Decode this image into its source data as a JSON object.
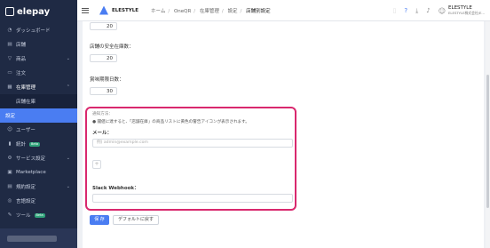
{
  "sidebar": {
    "brand": "elepay",
    "items": [
      {
        "label": "ダッシュボード",
        "icon": "dashboard-icon",
        "glyph": "◔"
      },
      {
        "label": "店舗",
        "icon": "store-icon",
        "glyph": "▤"
      },
      {
        "label": "商品",
        "icon": "tag-icon",
        "glyph": "▽"
      },
      {
        "label": "注文",
        "icon": "order-icon",
        "glyph": "▭"
      },
      {
        "label": "在庫管理",
        "icon": "inventory-icon",
        "glyph": "▦"
      },
      {
        "label": "店舗在庫",
        "icon": "",
        "glyph": ""
      },
      {
        "label": "設定",
        "icon": "",
        "glyph": ""
      },
      {
        "label": "ユーザー",
        "icon": "user-icon",
        "glyph": "☺"
      },
      {
        "label": "統計",
        "icon": "chart-icon",
        "glyph": "▮",
        "badge": "Beta"
      },
      {
        "label": "サービス設定",
        "icon": "gear-icon",
        "glyph": "⚙"
      },
      {
        "label": "Marketplace",
        "icon": "marketplace-icon",
        "glyph": "▣"
      },
      {
        "label": "規約設定",
        "icon": "document-icon",
        "glyph": "▤"
      },
      {
        "label": "言語設定",
        "icon": "globe-icon",
        "glyph": "◎"
      },
      {
        "label": "ツール",
        "icon": "wrench-icon",
        "glyph": "✎",
        "badge": "Beta"
      }
    ]
  },
  "topbar": {
    "brand": "ELESTYLE",
    "breadcrumbs": [
      "ホーム",
      "OneQR",
      "在庫管理",
      "設定",
      "店舗別設定"
    ],
    "user_name": "ELESTYLE",
    "user_sub": "ELESTYLE株式会社/E..."
  },
  "form": {
    "field1_value": "20",
    "safety_label": "店舗の安全在庫数：",
    "safety_value": "20",
    "days_label": "賞味期限日数：",
    "days_value": "30"
  },
  "notify": {
    "header": "通知方法：",
    "hint": "● 閾値に達すると、「店舗在庫」の商品リストに黄色の警告アイコンが表示されます。",
    "mail_label": "メール：",
    "mail_placeholder": "例) admin@example.com",
    "plus": "+",
    "slack_label": "Slack Webhook："
  },
  "buttons": {
    "save": "保 存",
    "default": "デフォルトに戻す"
  },
  "colors": {
    "sidebar": "#1f2a44",
    "accent": "#4a7df2",
    "highlight_border": "#d9286e"
  }
}
